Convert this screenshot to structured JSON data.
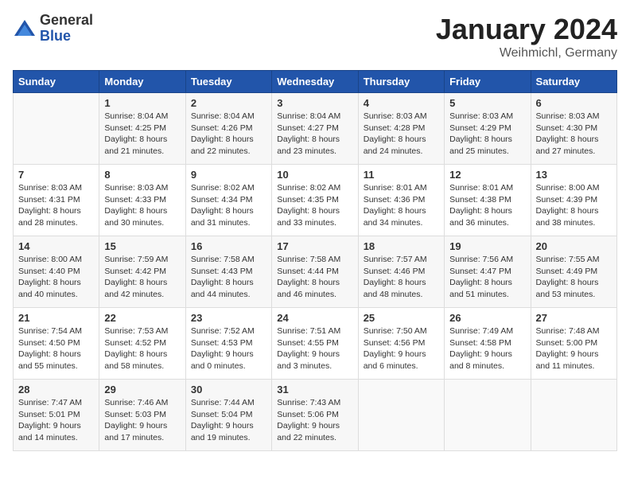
{
  "header": {
    "logo_general": "General",
    "logo_blue": "Blue",
    "month_title": "January 2024",
    "location": "Weihmichl, Germany"
  },
  "weekdays": [
    "Sunday",
    "Monday",
    "Tuesday",
    "Wednesday",
    "Thursday",
    "Friday",
    "Saturday"
  ],
  "weeks": [
    [
      {
        "day": "",
        "empty": true
      },
      {
        "day": "1",
        "sunrise": "Sunrise: 8:04 AM",
        "sunset": "Sunset: 4:25 PM",
        "daylight": "Daylight: 8 hours and 21 minutes."
      },
      {
        "day": "2",
        "sunrise": "Sunrise: 8:04 AM",
        "sunset": "Sunset: 4:26 PM",
        "daylight": "Daylight: 8 hours and 22 minutes."
      },
      {
        "day": "3",
        "sunrise": "Sunrise: 8:04 AM",
        "sunset": "Sunset: 4:27 PM",
        "daylight": "Daylight: 8 hours and 23 minutes."
      },
      {
        "day": "4",
        "sunrise": "Sunrise: 8:03 AM",
        "sunset": "Sunset: 4:28 PM",
        "daylight": "Daylight: 8 hours and 24 minutes."
      },
      {
        "day": "5",
        "sunrise": "Sunrise: 8:03 AM",
        "sunset": "Sunset: 4:29 PM",
        "daylight": "Daylight: 8 hours and 25 minutes."
      },
      {
        "day": "6",
        "sunrise": "Sunrise: 8:03 AM",
        "sunset": "Sunset: 4:30 PM",
        "daylight": "Daylight: 8 hours and 27 minutes."
      }
    ],
    [
      {
        "day": "7",
        "sunrise": "Sunrise: 8:03 AM",
        "sunset": "Sunset: 4:31 PM",
        "daylight": "Daylight: 8 hours and 28 minutes."
      },
      {
        "day": "8",
        "sunrise": "Sunrise: 8:03 AM",
        "sunset": "Sunset: 4:33 PM",
        "daylight": "Daylight: 8 hours and 30 minutes."
      },
      {
        "day": "9",
        "sunrise": "Sunrise: 8:02 AM",
        "sunset": "Sunset: 4:34 PM",
        "daylight": "Daylight: 8 hours and 31 minutes."
      },
      {
        "day": "10",
        "sunrise": "Sunrise: 8:02 AM",
        "sunset": "Sunset: 4:35 PM",
        "daylight": "Daylight: 8 hours and 33 minutes."
      },
      {
        "day": "11",
        "sunrise": "Sunrise: 8:01 AM",
        "sunset": "Sunset: 4:36 PM",
        "daylight": "Daylight: 8 hours and 34 minutes."
      },
      {
        "day": "12",
        "sunrise": "Sunrise: 8:01 AM",
        "sunset": "Sunset: 4:38 PM",
        "daylight": "Daylight: 8 hours and 36 minutes."
      },
      {
        "day": "13",
        "sunrise": "Sunrise: 8:00 AM",
        "sunset": "Sunset: 4:39 PM",
        "daylight": "Daylight: 8 hours and 38 minutes."
      }
    ],
    [
      {
        "day": "14",
        "sunrise": "Sunrise: 8:00 AM",
        "sunset": "Sunset: 4:40 PM",
        "daylight": "Daylight: 8 hours and 40 minutes."
      },
      {
        "day": "15",
        "sunrise": "Sunrise: 7:59 AM",
        "sunset": "Sunset: 4:42 PM",
        "daylight": "Daylight: 8 hours and 42 minutes."
      },
      {
        "day": "16",
        "sunrise": "Sunrise: 7:58 AM",
        "sunset": "Sunset: 4:43 PM",
        "daylight": "Daylight: 8 hours and 44 minutes."
      },
      {
        "day": "17",
        "sunrise": "Sunrise: 7:58 AM",
        "sunset": "Sunset: 4:44 PM",
        "daylight": "Daylight: 8 hours and 46 minutes."
      },
      {
        "day": "18",
        "sunrise": "Sunrise: 7:57 AM",
        "sunset": "Sunset: 4:46 PM",
        "daylight": "Daylight: 8 hours and 48 minutes."
      },
      {
        "day": "19",
        "sunrise": "Sunrise: 7:56 AM",
        "sunset": "Sunset: 4:47 PM",
        "daylight": "Daylight: 8 hours and 51 minutes."
      },
      {
        "day": "20",
        "sunrise": "Sunrise: 7:55 AM",
        "sunset": "Sunset: 4:49 PM",
        "daylight": "Daylight: 8 hours and 53 minutes."
      }
    ],
    [
      {
        "day": "21",
        "sunrise": "Sunrise: 7:54 AM",
        "sunset": "Sunset: 4:50 PM",
        "daylight": "Daylight: 8 hours and 55 minutes."
      },
      {
        "day": "22",
        "sunrise": "Sunrise: 7:53 AM",
        "sunset": "Sunset: 4:52 PM",
        "daylight": "Daylight: 8 hours and 58 minutes."
      },
      {
        "day": "23",
        "sunrise": "Sunrise: 7:52 AM",
        "sunset": "Sunset: 4:53 PM",
        "daylight": "Daylight: 9 hours and 0 minutes."
      },
      {
        "day": "24",
        "sunrise": "Sunrise: 7:51 AM",
        "sunset": "Sunset: 4:55 PM",
        "daylight": "Daylight: 9 hours and 3 minutes."
      },
      {
        "day": "25",
        "sunrise": "Sunrise: 7:50 AM",
        "sunset": "Sunset: 4:56 PM",
        "daylight": "Daylight: 9 hours and 6 minutes."
      },
      {
        "day": "26",
        "sunrise": "Sunrise: 7:49 AM",
        "sunset": "Sunset: 4:58 PM",
        "daylight": "Daylight: 9 hours and 8 minutes."
      },
      {
        "day": "27",
        "sunrise": "Sunrise: 7:48 AM",
        "sunset": "Sunset: 5:00 PM",
        "daylight": "Daylight: 9 hours and 11 minutes."
      }
    ],
    [
      {
        "day": "28",
        "sunrise": "Sunrise: 7:47 AM",
        "sunset": "Sunset: 5:01 PM",
        "daylight": "Daylight: 9 hours and 14 minutes."
      },
      {
        "day": "29",
        "sunrise": "Sunrise: 7:46 AM",
        "sunset": "Sunset: 5:03 PM",
        "daylight": "Daylight: 9 hours and 17 minutes."
      },
      {
        "day": "30",
        "sunrise": "Sunrise: 7:44 AM",
        "sunset": "Sunset: 5:04 PM",
        "daylight": "Daylight: 9 hours and 19 minutes."
      },
      {
        "day": "31",
        "sunrise": "Sunrise: 7:43 AM",
        "sunset": "Sunset: 5:06 PM",
        "daylight": "Daylight: 9 hours and 22 minutes."
      },
      {
        "day": "",
        "empty": true
      },
      {
        "day": "",
        "empty": true
      },
      {
        "day": "",
        "empty": true
      }
    ]
  ]
}
